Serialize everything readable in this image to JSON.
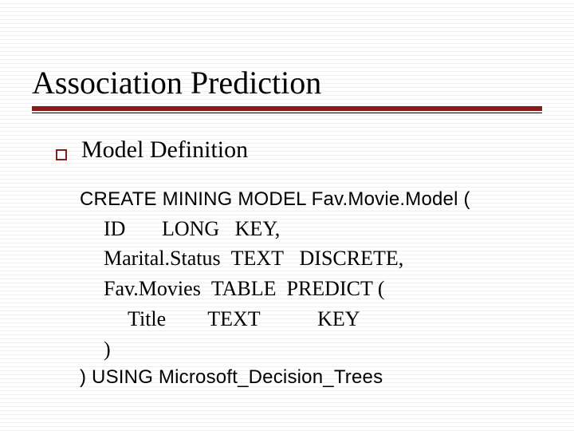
{
  "title": "Association Prediction",
  "subheading": "Model Definition",
  "code": {
    "lead": "CREATE MINING MODEL Fav.Movie.Model (",
    "lines": [
      {
        "indent": 1,
        "name": "ID",
        "gap1": "       ",
        "type": "LONG",
        "gap2": "   ",
        "attr": "KEY,"
      },
      {
        "indent": 1,
        "name": "Marital.Status",
        "gap1": "  ",
        "type": "TEXT",
        "gap2": "   ",
        "attr": "DISCRETE,"
      },
      {
        "indent": 1,
        "name": "Fav.Movies",
        "gap1": "  ",
        "type": "TABLE",
        "gap2": "  ",
        "attr": "PREDICT ("
      },
      {
        "indent": 2,
        "name": "Title",
        "gap1": "        ",
        "type": "TEXT",
        "gap2": "           ",
        "attr": "KEY"
      },
      {
        "indent": 1,
        "name": ")",
        "gap1": "",
        "type": "",
        "gap2": "",
        "attr": ""
      }
    ],
    "tail": ") USING Microsoft_Decision_Trees"
  }
}
